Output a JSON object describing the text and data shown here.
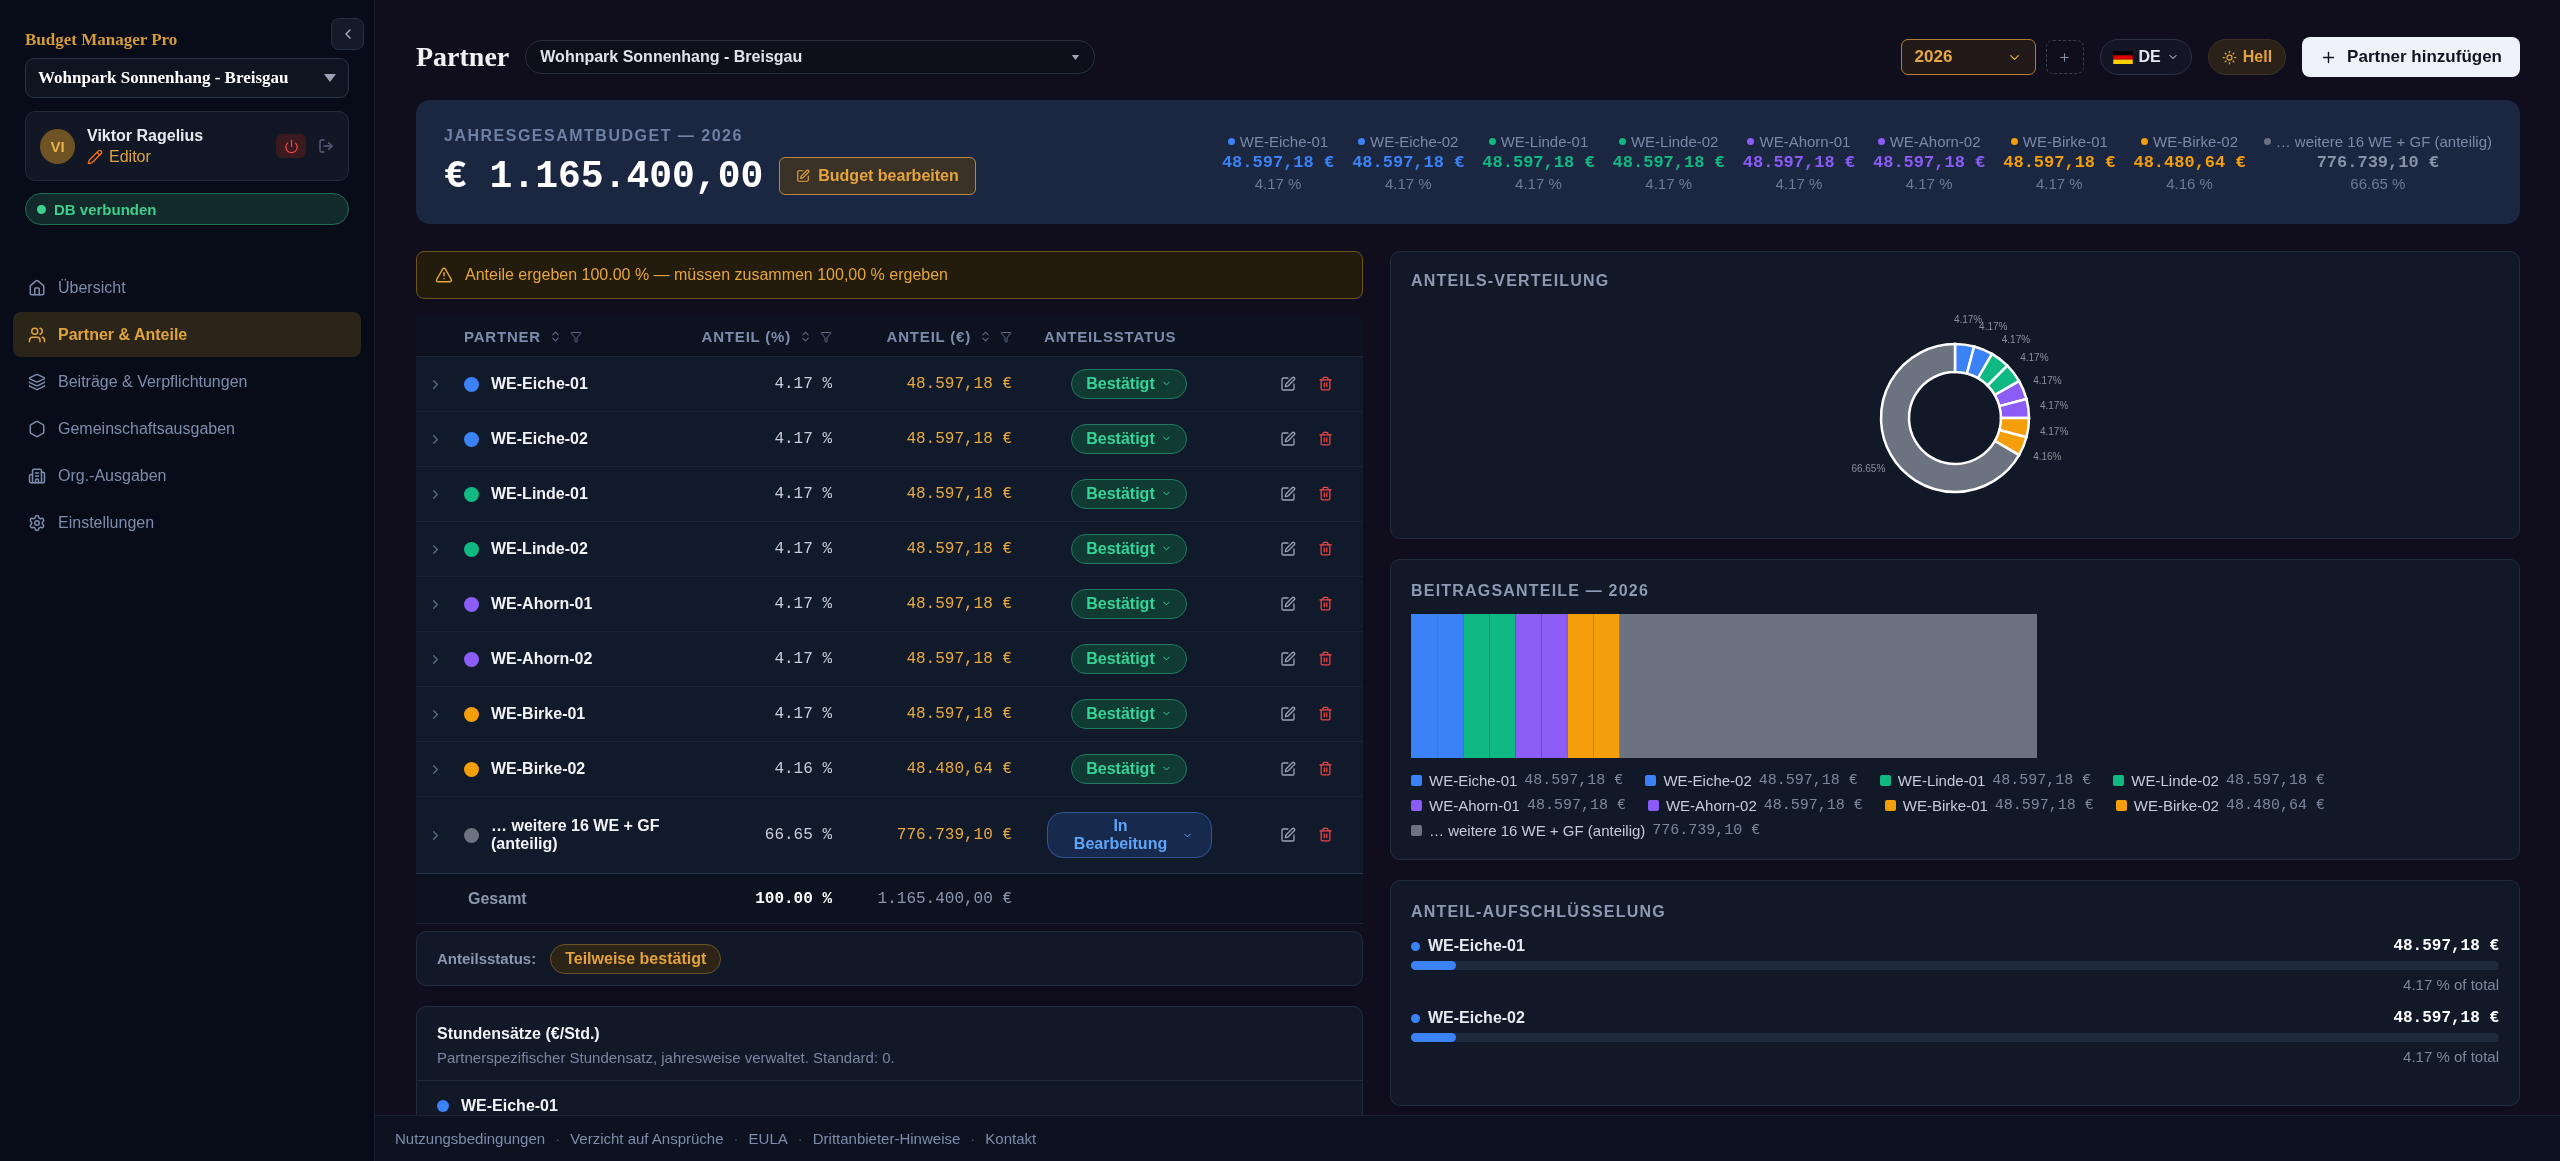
{
  "sidebar": {
    "app_title": "Budget Manager Pro",
    "project_select": "Wohnpark Sonnenhang - Breisgau",
    "user": {
      "initials": "VI",
      "name": "Viktor Ragelius",
      "role": "Editor"
    },
    "db_status": "DB verbunden",
    "nav": [
      {
        "label": "Übersicht",
        "selected": false
      },
      {
        "label": "Partner & Anteile",
        "selected": true
      },
      {
        "label": "Beiträge & Verpflichtungen",
        "selected": false
      },
      {
        "label": "Gemeinschaftsausgaben",
        "selected": false
      },
      {
        "label": "Org.-Ausgaben",
        "selected": false
      },
      {
        "label": "Einstellungen",
        "selected": false
      }
    ]
  },
  "header": {
    "title": "Partner",
    "project_select": "Wohnpark Sonnenhang - Breisgau",
    "year": "2026",
    "language": "DE",
    "theme_button": "Hell",
    "add_button": "Partner hinzufügen"
  },
  "budget": {
    "label": "JAHRESGESAMTBUDGET — 2026",
    "amount": "€ 1.165.400,00",
    "edit_button": "Budget bearbeiten",
    "partners": [
      {
        "name": "WE-Eiche-01",
        "color": "#3b82f6",
        "amount": "48.597,18 €",
        "percent": "4.17 %"
      },
      {
        "name": "WE-Eiche-02",
        "color": "#3b82f6",
        "amount": "48.597,18 €",
        "percent": "4.17 %"
      },
      {
        "name": "WE-Linde-01",
        "color": "#10b981",
        "amount": "48.597,18 €",
        "percent": "4.17 %"
      },
      {
        "name": "WE-Linde-02",
        "color": "#10b981",
        "amount": "48.597,18 €",
        "percent": "4.17 %"
      },
      {
        "name": "WE-Ahorn-01",
        "color": "#8b5cf6",
        "amount": "48.597,18 €",
        "percent": "4.17 %"
      },
      {
        "name": "WE-Ahorn-02",
        "color": "#8b5cf6",
        "amount": "48.597,18 €",
        "percent": "4.17 %"
      },
      {
        "name": "WE-Birke-01",
        "color": "#f59e0b",
        "amount": "48.597,18 €",
        "percent": "4.17 %"
      },
      {
        "name": "WE-Birke-02",
        "color": "#f59e0b",
        "amount": "48.480,64 €",
        "percent": "4.16 %"
      },
      {
        "name": "… weitere 16 WE + GF (anteilig)",
        "color": "#6b7280",
        "amount": "776.739,10 €",
        "percent": "66.65 %"
      }
    ]
  },
  "warning": "Anteile ergeben 100.00 % — müssen zusammen 100,00 % ergeben",
  "table": {
    "columns": [
      {
        "label": "PARTNER",
        "sortable": true,
        "filterable": true
      },
      {
        "label": "ANTEIL (%)",
        "sortable": true,
        "filterable": true
      },
      {
        "label": "ANTEIL (€)",
        "sortable": true,
        "filterable": true
      },
      {
        "label": "ANTEILSSTATUS",
        "sortable": false,
        "filterable": false
      }
    ],
    "rows": [
      {
        "name": "WE-Eiche-01",
        "color": "#3b82f6",
        "percent": "4.17 %",
        "amount": "48.597,18 €",
        "status": {
          "label": "Bestätigt",
          "kind": "confirmed"
        }
      },
      {
        "name": "WE-Eiche-02",
        "color": "#3b82f6",
        "percent": "4.17 %",
        "amount": "48.597,18 €",
        "status": {
          "label": "Bestätigt",
          "kind": "confirmed"
        }
      },
      {
        "name": "WE-Linde-01",
        "color": "#10b981",
        "percent": "4.17 %",
        "amount": "48.597,18 €",
        "status": {
          "label": "Bestätigt",
          "kind": "confirmed"
        }
      },
      {
        "name": "WE-Linde-02",
        "color": "#10b981",
        "percent": "4.17 %",
        "amount": "48.597,18 €",
        "status": {
          "label": "Bestätigt",
          "kind": "confirmed"
        }
      },
      {
        "name": "WE-Ahorn-01",
        "color": "#8b5cf6",
        "percent": "4.17 %",
        "amount": "48.597,18 €",
        "status": {
          "label": "Bestätigt",
          "kind": "confirmed"
        }
      },
      {
        "name": "WE-Ahorn-02",
        "color": "#8b5cf6",
        "percent": "4.17 %",
        "amount": "48.597,18 €",
        "status": {
          "label": "Bestätigt",
          "kind": "confirmed"
        }
      },
      {
        "name": "WE-Birke-01",
        "color": "#f59e0b",
        "percent": "4.17 %",
        "amount": "48.597,18 €",
        "status": {
          "label": "Bestätigt",
          "kind": "confirmed"
        }
      },
      {
        "name": "WE-Birke-02",
        "color": "#f59e0b",
        "percent": "4.16 %",
        "amount": "48.480,64 €",
        "status": {
          "label": "Bestätigt",
          "kind": "confirmed"
        }
      },
      {
        "name": "… weitere 16 WE + GF (anteilig)",
        "color": "#6b7280",
        "percent": "66.65 %",
        "amount": "776.739,10 €",
        "status": {
          "label": "In Bearbeitung",
          "kind": "in_progress"
        }
      }
    ],
    "total": {
      "label": "Gesamt",
      "percent": "100.00 %",
      "amount": "1.165.400,00 €"
    }
  },
  "share_status": {
    "label": "Anteilsstatus:",
    "value": "Teilweise bestätigt"
  },
  "rates": {
    "title": "Stundensätze (€/Std.)",
    "subtitle": "Partnerspezifischer Stundensatz, jahresweise verwaltet. Standard: 0.",
    "partners": [
      {
        "name": "WE-Eiche-01",
        "color": "#3b82f6"
      }
    ]
  },
  "distribution": {
    "title": "ANTEILS-VERTEILUNG",
    "chart_data": {
      "type": "donut",
      "values": [
        4.17,
        4.17,
        4.17,
        4.17,
        4.17,
        4.17,
        4.17,
        4.16,
        66.65
      ],
      "value_labels": [
        "4.17%",
        "4.17%",
        "4.17%",
        "4.17%",
        "4.17%",
        "4.17%",
        "4.17%",
        "4.16%",
        "66.65%"
      ]
    }
  },
  "contributions": {
    "title": "BEITRAGSANTEILE — 2026",
    "segments": [
      {
        "name": "WE-Eiche-01",
        "color": "#3b82f6",
        "amount": "48.597,18 €"
      },
      {
        "name": "WE-Eiche-02",
        "color": "#3b82f6",
        "amount": "48.597,18 €"
      },
      {
        "name": "WE-Linde-01",
        "color": "#10b981",
        "amount": "48.597,18 €"
      },
      {
        "name": "WE-Linde-02",
        "color": "#10b981",
        "amount": "48.597,18 €"
      },
      {
        "name": "WE-Ahorn-01",
        "color": "#8b5cf6",
        "amount": "48.597,18 €"
      },
      {
        "name": "WE-Ahorn-02",
        "color": "#8b5cf6",
        "amount": "48.597,18 €"
      },
      {
        "name": "WE-Birke-01",
        "color": "#f59e0b",
        "amount": "48.597,18 €"
      },
      {
        "name": "WE-Birke-02",
        "color": "#f59e0b",
        "amount": "48.480,64 €"
      },
      {
        "name": "… weitere 16 WE + GF (anteilig)",
        "color": "#6b7280",
        "amount": "776.739,10 €"
      }
    ]
  },
  "breakdown": {
    "title": "ANTEIL-AUFSCHLÜSSELUNG",
    "items": [
      {
        "name": "WE-Eiche-01",
        "color": "#3b82f6",
        "amount": "48.597,18 €",
        "level": 0.0417,
        "note": "4.17 % of total"
      },
      {
        "name": "WE-Eiche-02",
        "color": "#3b82f6",
        "amount": "48.597,18 €",
        "level": 0.0417,
        "note": "4.17 % of total"
      }
    ]
  },
  "footer_separator": "·",
  "footer": [
    "Nutzungsbedingungen",
    "Verzicht auf Ansprüche",
    "EULA",
    "Drittanbieter-Hinweise",
    "Kontakt"
  ]
}
